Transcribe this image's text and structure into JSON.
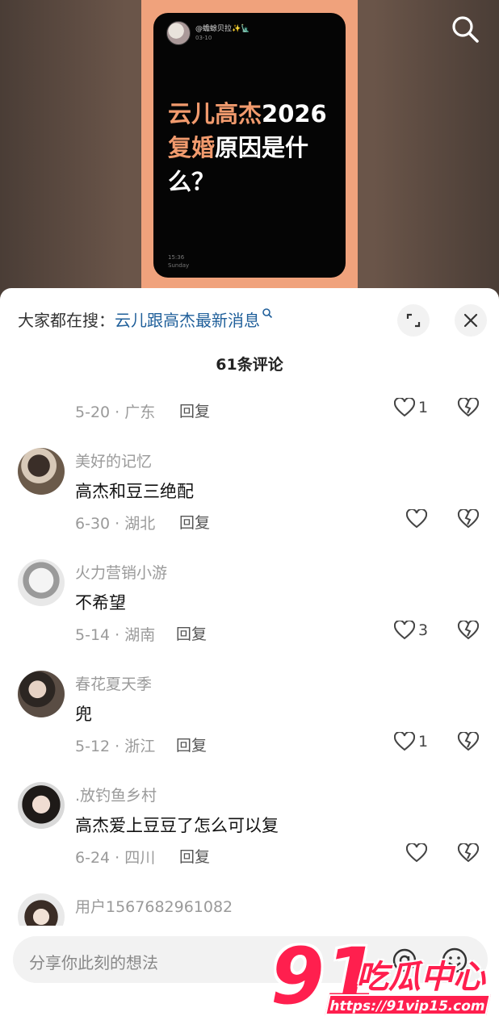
{
  "video": {
    "card_user": "@蟾蜍贝拉✨🗽",
    "card_date": "03-10",
    "headline_part1_highlight": "云儿高杰",
    "headline_part1_rest": "2026",
    "headline_part2_highlight": "复婚",
    "headline_part2_rest": "原因是什么？",
    "card_time": "15:36",
    "card_day": "Sunday"
  },
  "sheet": {
    "trend_prefix": "大家都在搜：",
    "trend_keyword": "云儿跟高杰最新消息",
    "comment_count": "61条评论",
    "reply_label": "回复",
    "input_placeholder": "分享你此刻的想法"
  },
  "comments": [
    {
      "user": "",
      "text": "",
      "meta": "5-20 · 广东",
      "likes": "1"
    },
    {
      "user": "美好的记忆",
      "text": "高杰和豆三绝配",
      "meta": "6-30 · 湖北",
      "likes": ""
    },
    {
      "user": "火力营销小游",
      "text": "不希望",
      "meta": "5-14 · 湖南",
      "likes": "3"
    },
    {
      "user": "春花夏天季",
      "text": "兜",
      "meta": "5-12 · 浙江",
      "likes": "1"
    },
    {
      "user": ".放钓鱼乡村",
      "text": "高杰爱上豆豆了怎么可以复",
      "meta": "6-24 · 四川",
      "likes": ""
    },
    {
      "user": "用户1567682961082",
      "text": "",
      "meta": "",
      "likes": ""
    }
  ],
  "watermark": {
    "brand_number": "91",
    "brand_text": "吃瓜中心",
    "url": "https://91vip15.com"
  },
  "icons": {
    "search": "search-icon",
    "expand": "expand-icon",
    "close": "close-icon",
    "like": "heart-icon",
    "dislike": "broken-heart-icon",
    "mention": "at-icon",
    "emoji": "emoji-icon"
  },
  "colors": {
    "accent_highlight": "#f19a6d",
    "trend_keyword": "#1f5f9a",
    "watermark": "#ff1f4e"
  }
}
